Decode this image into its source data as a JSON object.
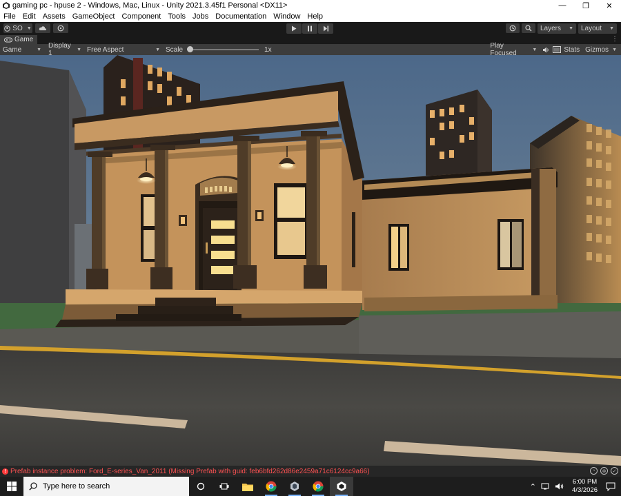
{
  "window": {
    "title": "gaming pc - hpuse 2 - Windows, Mac, Linux - Unity 2021.3.45f1 Personal <DX11>",
    "minimize_glyph": "—",
    "restore_glyph": "❐",
    "close_glyph": "✕"
  },
  "menu": [
    "File",
    "Edit",
    "Assets",
    "GameObject",
    "Component",
    "Tools",
    "Jobs",
    "Documentation",
    "Window",
    "Help"
  ],
  "toolbar": {
    "account_label": "SO",
    "layers_label": "Layers",
    "layout_label": "Layout"
  },
  "tab": {
    "label": "Game",
    "menu_glyph": "⋮"
  },
  "game_toolbar": {
    "mode": "Game",
    "display": "Display 1",
    "aspect": "Free Aspect",
    "scale_label": "Scale",
    "scale_value": "1x",
    "scale_fraction": 0,
    "play_mode": "Play Focused",
    "stats_label": "Stats",
    "gizmos_label": "Gizmos"
  },
  "console": {
    "message": "Prefab instance problem: Ford_E-series_Van_2011 (Missing Prefab with guid: feb6bfd262d86e2459a71c6124cc9a66)",
    "error_glyph": "!"
  },
  "taskbar": {
    "search_placeholder": "Type here to search",
    "time": "6:00 PM",
    "date": "4/3/2026"
  },
  "colors": {
    "unity_dark": "#191919",
    "panel": "#3c3c3c",
    "error": "#ff5252",
    "sky_top": "#4f6d8e",
    "wall": "#b88752"
  }
}
